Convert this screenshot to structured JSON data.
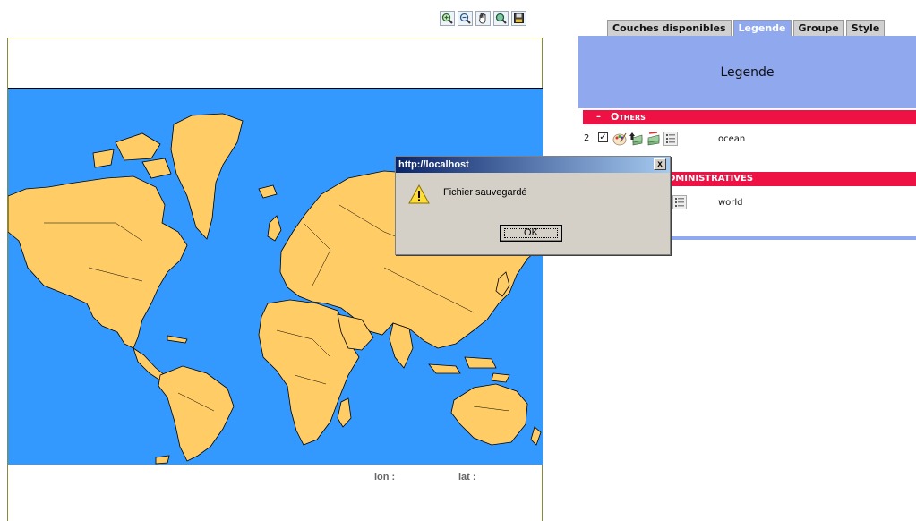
{
  "toolbar": {
    "buttons": [
      {
        "name": "zoom-in-icon"
      },
      {
        "name": "zoom-out-icon"
      },
      {
        "name": "pan-hand-icon"
      },
      {
        "name": "zoom-extent-icon"
      },
      {
        "name": "save-disk-icon"
      }
    ]
  },
  "map": {
    "ocean_color": "#3399ff",
    "land_color": "#ffcc66",
    "lon_label": "lon :",
    "lat_label": "lat :"
  },
  "panel": {
    "tabs": [
      "Couches disponibles",
      "Legende",
      "Groupe",
      "Style"
    ],
    "active_tab": "Legende",
    "header_title": "Legende",
    "accent_color": "#8fa8ee",
    "group_color": "#ee1144",
    "groups": [
      {
        "toggle": "–",
        "label": "Others",
        "layers": [
          {
            "order": "2",
            "checked": true,
            "name": "ocean"
          }
        ]
      },
      {
        "label": "DMINISTRATIVES",
        "layers": [
          {
            "name": "world"
          }
        ]
      }
    ]
  },
  "dialog": {
    "title": "http://localhost",
    "close": "x",
    "message": "Fichier sauvegardé",
    "ok_label": "OK"
  }
}
